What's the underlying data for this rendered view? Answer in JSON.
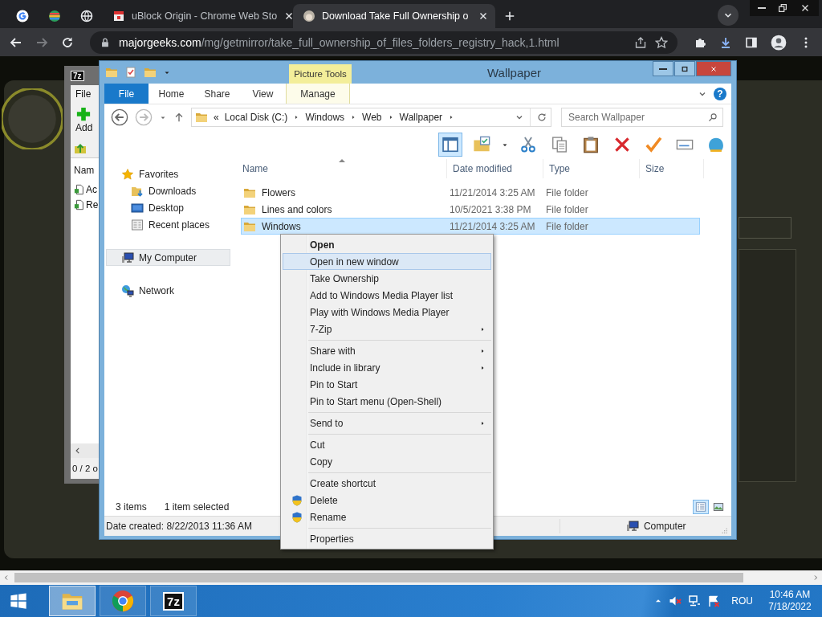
{
  "browser": {
    "tabs": [
      {
        "selected": false
      },
      {
        "selected": false
      },
      {
        "selected": false
      },
      {
        "title": "uBlock Origin - Chrome Web Sto",
        "selected": false
      },
      {
        "title": "Download Take Full Ownership o",
        "selected": true
      }
    ],
    "nav_buttons": [
      {
        "disabled": false
      },
      {
        "disabled": true
      },
      {
        "disabled": false
      }
    ],
    "url": {
      "host": "majorgeeks.com",
      "path": "/mg/getmirror/take_full_ownership_of_files_folders_registry_hack,1.html"
    }
  },
  "sevenzip": {
    "logo": "7z",
    "menu": "File",
    "add": "Add",
    "column": "Nam",
    "rows": [
      "Ac",
      "Re"
    ],
    "status": "0 / 2 o"
  },
  "explorer": {
    "title": "Wallpaper",
    "context_tab": "Picture Tools",
    "ribbon_tabs": [
      {
        "label": "File",
        "kind": "backstage"
      },
      {
        "label": "Home",
        "kind": "tab"
      },
      {
        "label": "Share",
        "kind": "tab"
      },
      {
        "label": "View",
        "kind": "tab"
      },
      {
        "label": "Manage",
        "kind": "contextual"
      }
    ],
    "help": "?",
    "address": {
      "overflow": "«",
      "crumbs": [
        "Local Disk (C:)",
        "Windows",
        "Web",
        "Wallpaper"
      ]
    },
    "search_placeholder": "Search Wallpaper",
    "preview_pane_on": true,
    "nav": [
      {
        "label": "Favorites",
        "selected": false,
        "children": [
          {
            "label": "Downloads",
            "selected": false
          },
          {
            "label": "Desktop",
            "selected": false
          },
          {
            "label": "Recent places",
            "selected": false
          }
        ]
      },
      {
        "label": "My Computer",
        "selected": true
      },
      {
        "label": "Network",
        "selected": false
      }
    ],
    "columns": [
      "Name",
      "Date modified",
      "Type",
      "Size"
    ],
    "files": [
      {
        "name": "Flowers",
        "date": "11/21/2014 3:25 AM",
        "type": "File folder",
        "selected": false
      },
      {
        "name": "Lines and colors",
        "date": "10/5/2021 3:38 PM",
        "type": "File folder",
        "selected": false
      },
      {
        "name": "Windows",
        "date": "11/21/2014 3:25 AM",
        "type": "File folder",
        "selected": true
      }
    ],
    "status": {
      "count": "3 items",
      "selection": "1 item selected",
      "details": "Date created: 8/22/2013 11:36 AM",
      "location": "Computer"
    },
    "views": [
      {
        "kind": "details",
        "selected": true
      },
      {
        "kind": "large",
        "selected": false
      }
    ]
  },
  "context_menu": {
    "groups": [
      [
        {
          "label": "Open",
          "default": true,
          "selected": false,
          "submenu": false,
          "shield": false
        },
        {
          "label": "Open in new window",
          "default": false,
          "selected": true,
          "submenu": false,
          "shield": false
        },
        {
          "label": "Take Ownership",
          "default": false,
          "selected": false,
          "submenu": false,
          "shield": false
        },
        {
          "label": "Add to Windows Media Player list",
          "default": false,
          "selected": false,
          "submenu": false,
          "shield": false
        },
        {
          "label": "Play with Windows Media Player",
          "default": false,
          "selected": false,
          "submenu": false,
          "shield": false
        },
        {
          "label": "7-Zip",
          "default": false,
          "selected": false,
          "submenu": true,
          "shield": false
        }
      ],
      [
        {
          "label": "Share with",
          "default": false,
          "selected": false,
          "submenu": true,
          "shield": false
        },
        {
          "label": "Include in library",
          "default": false,
          "selected": false,
          "submenu": true,
          "shield": false
        },
        {
          "label": "Pin to Start",
          "default": false,
          "selected": false,
          "submenu": false,
          "shield": false
        },
        {
          "label": "Pin to Start menu (Open-Shell)",
          "default": false,
          "selected": false,
          "submenu": false,
          "shield": false
        }
      ],
      [
        {
          "label": "Send to",
          "default": false,
          "selected": false,
          "submenu": true,
          "shield": false
        }
      ],
      [
        {
          "label": "Cut",
          "default": false,
          "selected": false,
          "submenu": false,
          "shield": false
        },
        {
          "label": "Copy",
          "default": false,
          "selected": false,
          "submenu": false,
          "shield": false
        }
      ],
      [
        {
          "label": "Create shortcut",
          "default": false,
          "selected": false,
          "submenu": false,
          "shield": false
        },
        {
          "label": "Delete",
          "default": false,
          "selected": false,
          "submenu": false,
          "shield": true
        },
        {
          "label": "Rename",
          "default": false,
          "selected": false,
          "submenu": false,
          "shield": true
        }
      ],
      [
        {
          "label": "Properties",
          "default": false,
          "selected": false,
          "submenu": false,
          "shield": false
        }
      ]
    ]
  },
  "taskbar": {
    "apps": [
      {
        "selected": true
      },
      {
        "selected": false
      },
      {
        "label": "7z",
        "selected": false
      }
    ],
    "language": "ROU",
    "time": "10:46 AM",
    "date": "7/18/2022"
  }
}
